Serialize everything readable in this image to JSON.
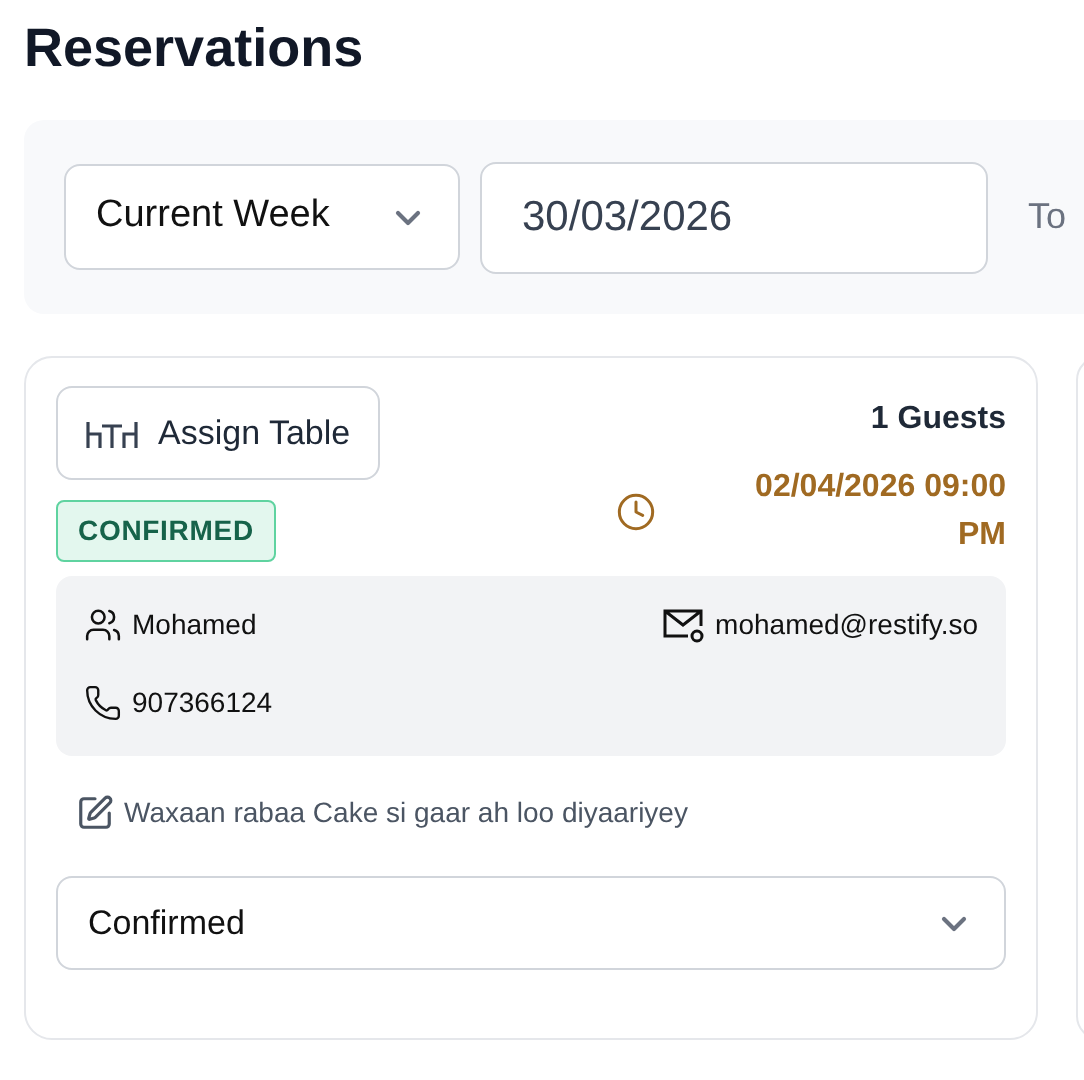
{
  "page": {
    "title": "Reservations"
  },
  "filters": {
    "period": "Current Week",
    "from_date": "30/03/2026",
    "to_label": "To"
  },
  "reservation": {
    "assign_button": "Assign Table",
    "status_badge": "CONFIRMED",
    "guests": "1 Guests",
    "datetime": "02/04/2026 09:00 PM",
    "customer": {
      "name": "Mohamed",
      "email": "mohamed@restify.so",
      "phone": "907366124"
    },
    "note": "Waxaan rabaa Cake si gaar ah loo diyaariyey",
    "status_select": "Confirmed"
  }
}
